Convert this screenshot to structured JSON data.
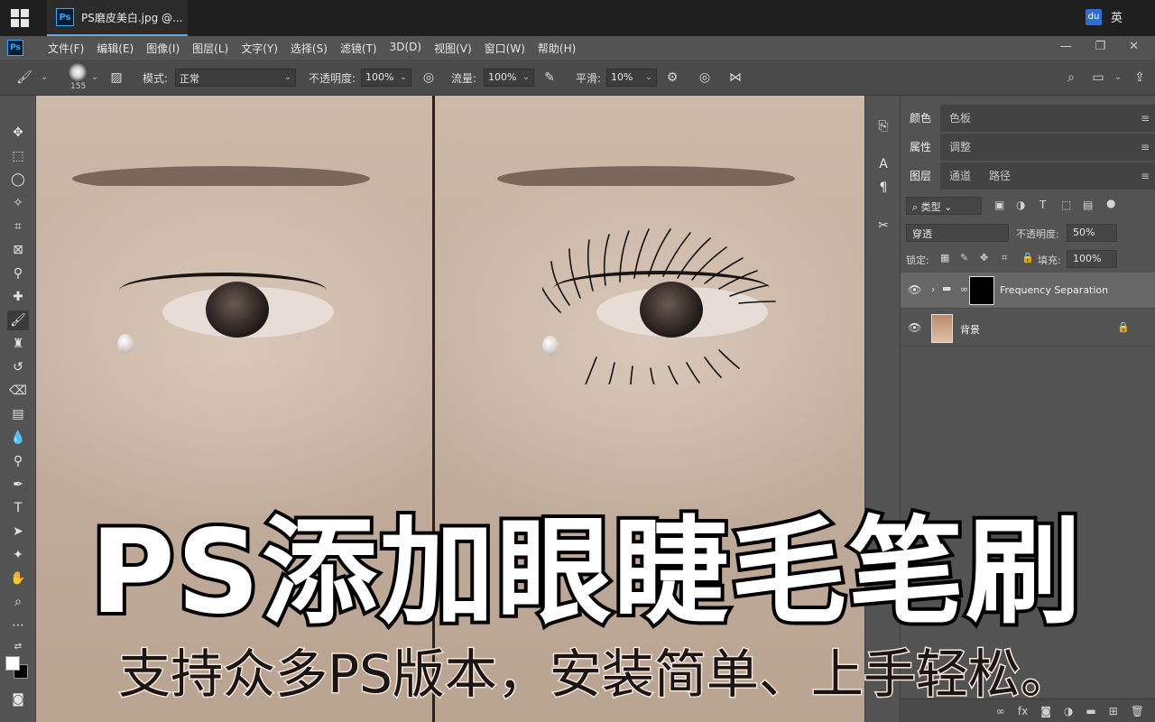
{
  "window": {
    "tab_title": "PS磨皮美白.jpg @...",
    "app_badge": "Ps",
    "ime_badge": "du",
    "ime_lang": "英",
    "controls": [
      "—",
      "❐",
      "✕"
    ]
  },
  "menubar": {
    "items": [
      "文件(F)",
      "编辑(E)",
      "图像(I)",
      "图层(L)",
      "文字(Y)",
      "选择(S)",
      "滤镜(T)",
      "3D(D)",
      "视图(V)",
      "窗口(W)",
      "帮助(H)"
    ]
  },
  "options": {
    "brush_size": "155",
    "mode_label": "模式:",
    "mode_value": "正常",
    "opacity_label": "不透明度:",
    "opacity_value": "100%",
    "flow_label": "流量:",
    "flow_value": "100%",
    "smoothing_label": "平滑:",
    "smoothing_value": "10%"
  },
  "panels": {
    "group1_tabs": [
      "颜色",
      "色板"
    ],
    "group2_tabs": [
      "属性",
      "调整"
    ],
    "layers_tabs": [
      "图层",
      "通道",
      "路径"
    ],
    "filter_kind": "类型",
    "blend_mode": "穿透",
    "layer_opacity_label": "不透明度:",
    "layer_opacity_value": "50%",
    "lock_label": "锁定:",
    "fill_label": "填充:",
    "fill_value": "100%",
    "layers": [
      {
        "name": "Frequency Separation",
        "type": "group",
        "selected": true
      },
      {
        "name": "背景",
        "type": "image",
        "locked": true
      }
    ]
  },
  "overlay": {
    "headline": "PS添加眼睫毛笔刷",
    "subline": "支持众多PS版本，安装简单、上手轻松。"
  },
  "colors": {
    "accent": "#31a8ff",
    "panel_bg": "#535353",
    "foreground": "#ffffff",
    "background": "#000000"
  }
}
